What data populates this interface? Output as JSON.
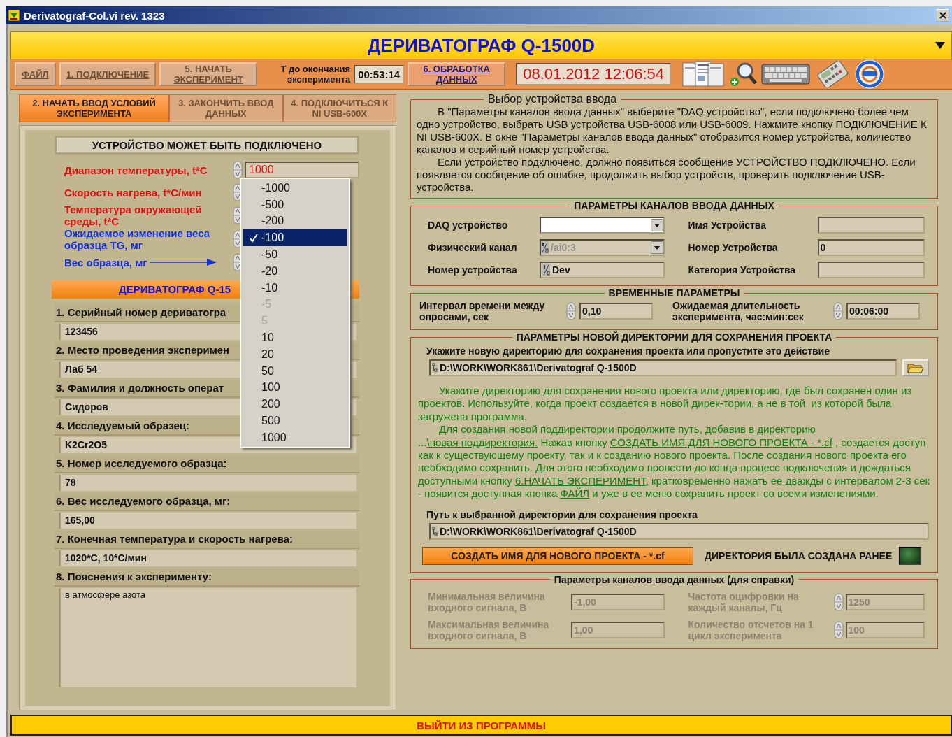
{
  "window": {
    "title": "Derivatograf-Col.vi rev. 1323"
  },
  "header": {
    "title": "ДЕРИВАТОГРАФ Q-1500D"
  },
  "toolbar": [
    {
      "kind": "button",
      "label": "ФАЙЛ",
      "disabled": true
    },
    {
      "kind": "button",
      "label": "1. ПОДКЛЮЧЕНИЕ",
      "disabled": true
    },
    {
      "kind": "button",
      "label": "5. НАЧАТЬ ЭКСПЕРИМЕНТ",
      "disabled": true
    },
    {
      "kind": "label",
      "label": "Т до окончания эксперимента"
    },
    {
      "kind": "field",
      "value": "00:53:14"
    },
    {
      "kind": "button",
      "label": "6. ОБРАБОТКА ДАННЫХ",
      "disabled": false
    },
    {
      "kind": "clock",
      "value": "08.01.2012 12:06:54"
    }
  ],
  "steps": [
    {
      "label": "2. НАЧАТЬ ВВОД УСЛОВИЙ ЭКСПЕРИМЕНТА",
      "disabled": false
    },
    {
      "label": "3. ЗАКОНЧИТЬ ВВОД ДАННЫХ",
      "disabled": true
    },
    {
      "label": "4. ПОДКЛЮЧИТЬСЯ К NI USB-600X",
      "disabled": true
    }
  ],
  "status": "УСТРОЙСТВО МОЖЕТ БЫТЬ ПОДКЛЮЧЕНО",
  "parameters": [
    {
      "label": "Диапазон температуры, t*C",
      "color": "#e01010",
      "value": "1000",
      "arrow": false
    },
    {
      "label": "Скорость нагрева, t*C/мин",
      "color": "#e01010",
      "arrow": false
    },
    {
      "label": "Температура окружающей среды,  t*C",
      "color": "#e01010",
      "arrow": false
    },
    {
      "label": "Ожидаемое изменение веса образца TG, мг",
      "color": "#1030e0",
      "arrow": false
    },
    {
      "label": "Вес образца, мг",
      "color": "#1030e0",
      "arrow": true
    }
  ],
  "menu": {
    "items": [
      {
        "label": "-1000",
        "selected": false,
        "disabled": false
      },
      {
        "label": "-500",
        "selected": false,
        "disabled": false
      },
      {
        "label": "-200",
        "selected": false,
        "disabled": false
      },
      {
        "label": "-100",
        "selected": true,
        "disabled": false
      },
      {
        "label": "-50",
        "selected": false,
        "disabled": false
      },
      {
        "label": "-20",
        "selected": false,
        "disabled": false
      },
      {
        "label": "-10",
        "selected": false,
        "disabled": false
      },
      {
        "label": "-5",
        "selected": false,
        "disabled": true
      },
      {
        "label": "5",
        "selected": false,
        "disabled": true
      },
      {
        "label": "10",
        "selected": false,
        "disabled": false
      },
      {
        "label": "20",
        "selected": false,
        "disabled": false
      },
      {
        "label": "50",
        "selected": false,
        "disabled": false
      },
      {
        "label": "100",
        "selected": false,
        "disabled": false
      },
      {
        "label": "200",
        "selected": false,
        "disabled": false
      },
      {
        "label": "500",
        "selected": false,
        "disabled": false
      },
      {
        "label": "1000",
        "selected": false,
        "disabled": false
      }
    ]
  },
  "banner": "ДЕРИВАТОГРАФ Q-15",
  "form": [
    {
      "kind": "line",
      "label": "1. Серийный номер дериватогра",
      "value": "123456"
    },
    {
      "kind": "line",
      "label": "2. Место проведения эксперимен",
      "value": "Лаб 54"
    },
    {
      "kind": "line",
      "label": "3. Фамилия и должность операт",
      "value": "Сидоров"
    },
    {
      "kind": "line",
      "label": "4. Исследуемый образец:",
      "value": "K2Cr2O5"
    },
    {
      "kind": "line",
      "label": "5. Номер исследуемого образца:",
      "value": "78"
    },
    {
      "kind": "line",
      "label": "6. Вес исследуемого образца, мг:",
      "value": "165,00"
    },
    {
      "kind": "line",
      "label": "7. Конечная температура и скорость нагрева:",
      "value": "1020*C, 10*C/мин"
    },
    {
      "kind": "area",
      "label": "8. Пояснения к эксперименту:",
      "value": "в атмосфере азота"
    }
  ],
  "device_select": {
    "title": "Выбор устройства ввода",
    "paragraphs": [
      "В \"Параметры каналов ввода данных\" выберите \"DAQ устройство\", если подключено более чем одно устройство, выбрать USB устройства USB-6008 или USB-6009. Нажмите кнопку ПОДКЛЮЧЕНИЕ К NI USB-600X. В окне \"Параметры каналов ввода данных\"  отобразится номер устройства, количество каналов и серийный номер устройства.",
      "Если устройство подключено, должно появиться сообщение УСТРОЙСТВО ПОДКЛЮЧЕНО.  Если появляется сообщение об ошибке, продолжить выбор устройств, проверить подключение USB-устройства."
    ]
  },
  "channels": {
    "title": "ПАРАМЕТРЫ КАНАЛОВ ВВОДА ДАННЫХ",
    "fields": [
      {
        "kind": "dropdown",
        "label": "DAQ устройство"
      },
      {
        "kind": "field",
        "label": "Имя Устройства"
      },
      {
        "kind": "io-dropdown",
        "label": "Физический канал",
        "value": "/ai0:3",
        "disabled": true
      },
      {
        "kind": "field",
        "label": "Номер Устройства",
        "value": "0"
      },
      {
        "kind": "io-field",
        "label": "Номер устройства",
        "value": "Dev"
      },
      {
        "kind": "field",
        "label": "Категория Устройства"
      }
    ]
  },
  "timing": {
    "title": "ВРЕМЕННЫЕ ПАРАМЕТРЫ",
    "fields": [
      {
        "label": "Интервал времени между опросами, сек",
        "value": "0,10"
      },
      {
        "label": "Ожидаемая длительность эксперимента,  час:мин:сек",
        "value": "00:06:00"
      }
    ]
  },
  "directory": {
    "title": "ПАРАМЕТРЫ НОВОЙ ДИРЕКТОРИИ ДЛЯ СОХРАНЕНИЯ ПРОЕКТА",
    "prompt": "Укажите новую директорию для сохранения проекта или пропустите это действие",
    "path": "D:\\WORK\\WORK861\\Derivatograf Q-1500D",
    "paragraphs": [
      [
        {
          "text": "Укажите директорию для сохранения нового проекта или директорию, где был сохранен один из проектов. Используйте, когда проект создается в новой дирек-тории, а не в той, из которой была загружена программа.",
          "link": false
        }
      ],
      [
        {
          "text": "Для создания новой поддиректории продолжите путь, добавив в директорию ...",
          "link": false
        },
        {
          "text": "\\новая поддиректория.",
          "link": true
        },
        {
          "text": "  Нажав кнопку ",
          "link": false
        },
        {
          "text": "СОЗДАТЬ ИМЯ ДЛЯ НОВОГО ПРОЕКТА - *.cf",
          "link": true
        },
        {
          "text": " , создается доступ как к существующему проекту, так и к созданию нового проекта. После создания нового проекта его необходимо сохранить. Для этого необходимо провести до конца процесс подключения и дождаться доступными кнопку ",
          "link": false
        },
        {
          "text": "6.НАЧАТЬ ЭКСПЕРИМЕНТ",
          "link": true
        },
        {
          "text": ", кратковременно нажать ее дважды с интервалом 2-3 сек - появится доступная кнопка ",
          "link": false
        },
        {
          "text": "ФАЙЛ",
          "link": true
        },
        {
          "text": " и уже в ее меню сохранить проект со всеми изменениями.",
          "link": false
        }
      ]
    ],
    "path_label": "Путь к выбранной директории для сохранения проекта",
    "selected_path": "D:\\WORK\\WORK861\\Derivatograf Q-1500D",
    "create_button": "СОЗДАТЬ ИМЯ ДЛЯ НОВОГО ПРОЕКТА - *.cf",
    "indicator": {
      "label": "ДИРЕКТОРИЯ БЫЛА СОЗДАНА РАНЕЕ",
      "on": false
    }
  },
  "reference": {
    "title": "Параметры каналов ввода данных (для справки)",
    "fields": [
      {
        "kind": "numeric",
        "label": "Минимальная величина входного сигнала, В",
        "value": "-1,00",
        "disabled": true
      },
      {
        "kind": "spin",
        "label": "Частота оцифровки на каждый каналы, Гц",
        "value": "1250",
        "disabled": true
      },
      {
        "kind": "numeric",
        "label": "Максимальная величина входного сигнала, В",
        "value": "1,00",
        "disabled": true
      },
      {
        "kind": "spin",
        "label": "Количество отсчетов на 1 цикл эксперимента",
        "value": "100",
        "disabled": true
      }
    ]
  },
  "exit_button": "ВЫЙТИ ИЗ ПРОГРАММЫ"
}
